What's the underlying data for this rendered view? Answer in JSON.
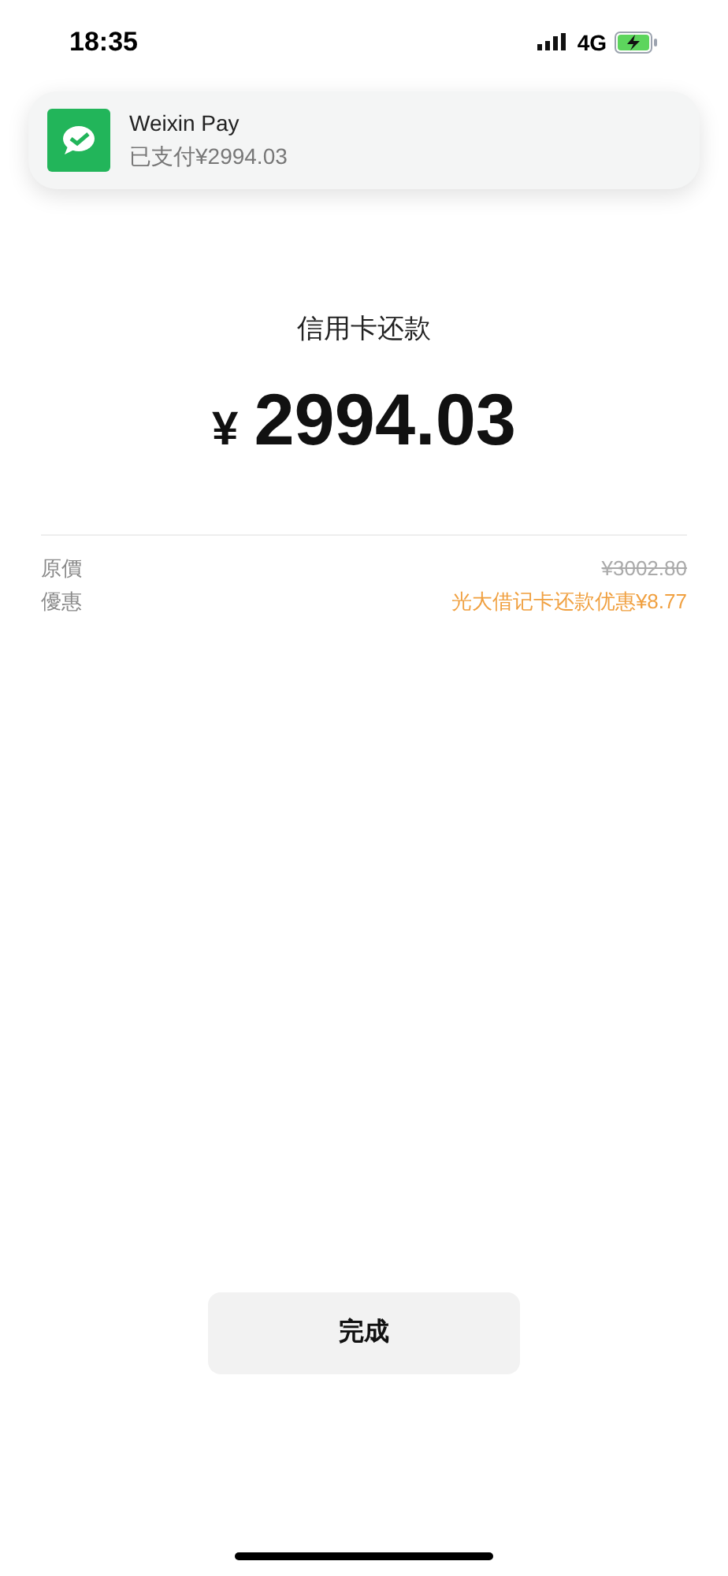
{
  "status_bar": {
    "time": "18:35",
    "network": "4G"
  },
  "notification": {
    "app": "Weixin Pay",
    "message": "已支付¥2994.03"
  },
  "payment": {
    "title": "信用卡还款",
    "currency": "¥",
    "amount": "2994.03"
  },
  "details": [
    {
      "label": "原價",
      "value": "¥3002.80",
      "kind": "struck"
    },
    {
      "label": "優惠",
      "value": "光大借记卡还款优惠¥8.77",
      "kind": "discount"
    }
  ],
  "done_button": "完成"
}
